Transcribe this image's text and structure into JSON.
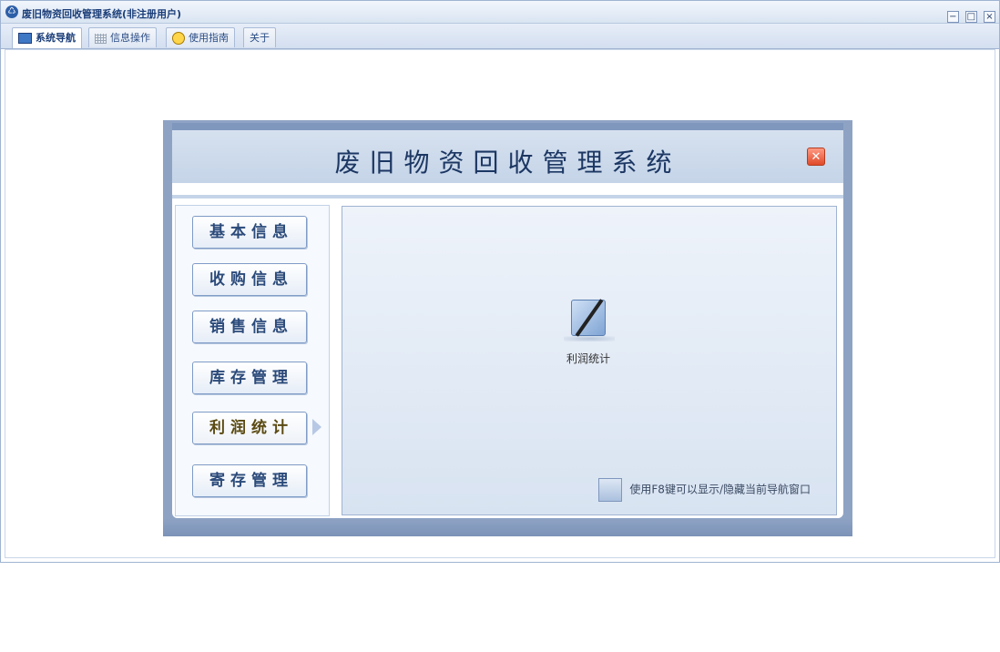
{
  "window": {
    "title": "废旧物资回收管理系统(非注册用户)",
    "controls": [
      "−",
      "□",
      "×"
    ]
  },
  "tabs": [
    {
      "label": "系统导航",
      "icon": "nav-icon",
      "active": true
    },
    {
      "label": "信息操作",
      "icon": "grid-icon",
      "active": false
    },
    {
      "label": "使用指南",
      "icon": "bulb-icon",
      "active": false
    },
    {
      "label": "关于",
      "icon": "",
      "active": false
    }
  ],
  "panel": {
    "title": "废旧物资回收管理系统",
    "close_glyph": "✕"
  },
  "nav": {
    "items": [
      {
        "label": "基本信息",
        "active": false
      },
      {
        "label": "收购信息",
        "active": false
      },
      {
        "label": "销售信息",
        "active": false
      },
      {
        "label": "库存管理",
        "active": false
      },
      {
        "label": "利润统计",
        "active": true
      },
      {
        "label": "寄存管理",
        "active": false
      }
    ]
  },
  "main": {
    "feature_label": "利润统计",
    "hint": "使用F8键可以显示/隐藏当前导航窗口"
  },
  "colors": {
    "accent": "#2b4a7a",
    "frame": "#8ea3c4"
  }
}
